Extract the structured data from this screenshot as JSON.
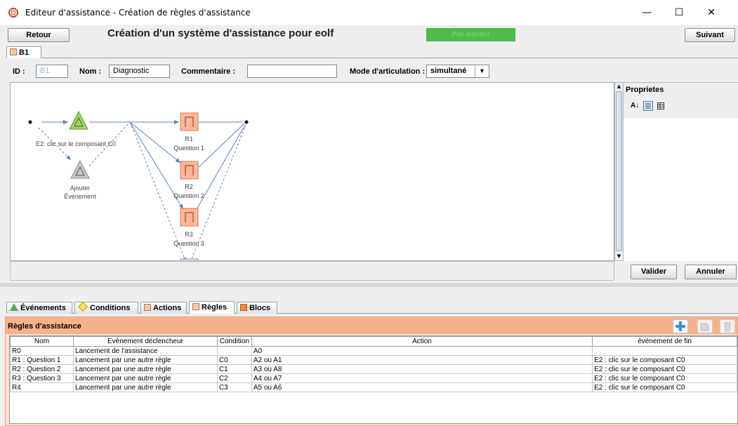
{
  "window": {
    "title": "Editeur d'assistance - Création de règles d'assistance",
    "minimize": "—",
    "maximize": "☐",
    "close": "✕"
  },
  "toolbar": {
    "back_label": "Retour",
    "heading": "Création d'un système d'assistance pour eolf",
    "status_text": "Pas d'erreur",
    "next_label": "Suivant"
  },
  "block_tab": {
    "label": "B1"
  },
  "form": {
    "id_label": "ID :",
    "id_value": "B1",
    "name_label": "Nom :",
    "name_value": "Diagnostic",
    "comment_label": "Commentaire :",
    "comment_value": "",
    "mode_label": "Mode d'articulation :",
    "mode_value": "simultané"
  },
  "diagram": {
    "event_label": "E2: clic sur le composant C0",
    "add_event_label_1": "Ajouter",
    "add_event_label_2": "Événement",
    "nodes": [
      {
        "name": "R1",
        "sub": "Question 1"
      },
      {
        "name": "R2",
        "sub": "Question 2"
      },
      {
        "name": "R3",
        "sub": "Question 3"
      }
    ]
  },
  "properties": {
    "title": "Proprietes",
    "sort_icon": "sort-az-icon",
    "categorized_icon": "categorized-icon",
    "list_icon": "list-icon"
  },
  "buttons": {
    "validate_label": "Valider",
    "cancel_label": "Annuler"
  },
  "bottom_tabs": [
    {
      "label": "Événements",
      "icon": "event-triangle-icon"
    },
    {
      "label": "Conditions",
      "icon": "condition-diamond-icon"
    },
    {
      "label": "Actions",
      "icon": "action-square-icon"
    },
    {
      "label": "Règles",
      "icon": "rule-square-icon"
    },
    {
      "label": "Blocs",
      "icon": "block-square-icon"
    }
  ],
  "rules_panel": {
    "title": "Règles d'assistance",
    "colors": {
      "header_bg": "#f6b38a",
      "tab_active": "#ffffff"
    },
    "columns": [
      "Nom",
      "Evènement déclencheur",
      "Condition",
      "Action",
      "événement de fin"
    ],
    "rows": [
      [
        "R0",
        "Lancement de l'assistance",
        "",
        "A0",
        ""
      ],
      [
        "R1 : Question 1",
        "Lancement par une autre règle",
        "C0",
        "A2 ou A1",
        "E2 : clic sur le composant C0"
      ],
      [
        "R2 : Question 2",
        "Lancement par une autre règle",
        "C1",
        "A3 ou A8",
        "E2 : clic sur le composant C0"
      ],
      [
        "R3 : Question 3",
        "Lancement par une autre règle",
        "C2",
        "A4 ou A7",
        "E2 : clic sur le composant C0"
      ],
      [
        "R4",
        "Lancement par une autre règle",
        "C3",
        "A5 ou A6",
        "E2 : clic sur le composant C0"
      ]
    ]
  }
}
